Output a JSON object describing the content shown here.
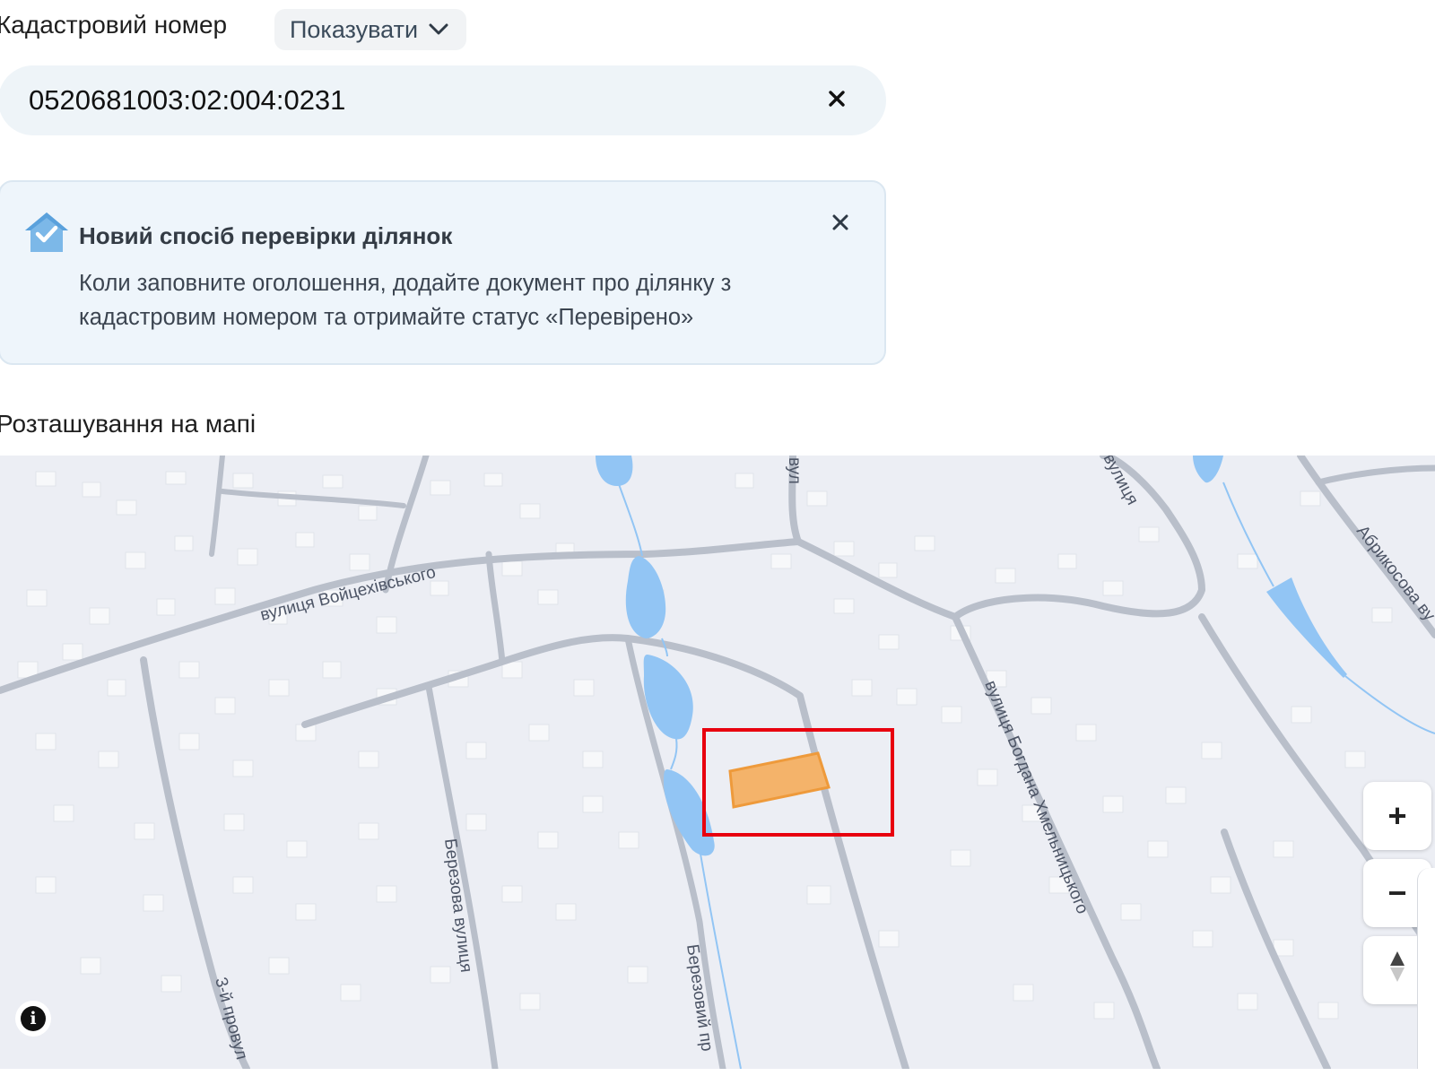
{
  "cadastral": {
    "label": "Кадастровий номер",
    "show_button": "Показувати",
    "value": "0520681003:02:004:0231",
    "icons": {
      "dropdown": "chevron-down-icon",
      "clear": "close-icon"
    }
  },
  "notice": {
    "title": "Новий спосіб перевірки ділянок",
    "text": "Коли заповните оголошення, додайте документ про ділянку з кадастровим номером та отримайте статус «Перевірено»",
    "icons": {
      "badge": "verified-house-icon",
      "close": "close-icon"
    },
    "colors": {
      "background": "#eef5fb",
      "border": "#dbe7f1",
      "icon": "#7cb8e8"
    }
  },
  "map": {
    "label": "Розташування на мапі",
    "streets": {
      "voitsekhivskoho": "вулиця Войцехівського",
      "berezova": "Березова вулиця",
      "bohdana": "вулиця Богдана Хмельницького",
      "abrykosova": "Абрикосова ву",
      "provulok3": "3-й провул",
      "berezovyi": "Березовий пр",
      "top_small": "вул",
      "top_right": "вулиця"
    },
    "controls": {
      "zoom_in": "+",
      "zoom_out": "−",
      "compass_icon": "compass-icon",
      "info_icon": "info-icon"
    },
    "colors": {
      "background": "#eceef4",
      "road": "#b9bfca",
      "water": "#92c5f4",
      "parcel_fill": "#f4b36a",
      "parcel_stroke": "#ee9a3b",
      "highlight": "#e8000e"
    }
  }
}
